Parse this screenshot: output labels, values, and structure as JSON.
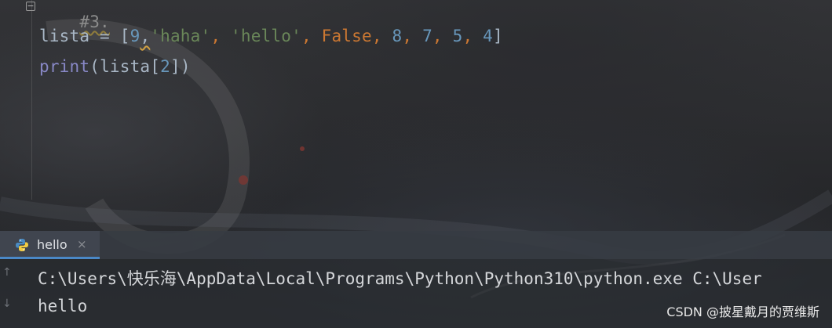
{
  "editor": {
    "comment_line": "#3.",
    "line2": {
      "var": "lista",
      "assign": " = ",
      "open": "[",
      "n9": "9",
      "comma_warn": ",",
      "s1": "'haha'",
      "sep1": ", ",
      "s2": "'hello'",
      "sep2": ", ",
      "kw_false": "False",
      "sep3": ", ",
      "n8": "8",
      "sep4": ", ",
      "n7": "7",
      "sep5": ", ",
      "n5": "5",
      "sep6": ", ",
      "n4": "4",
      "close": "]"
    },
    "line3": {
      "fn": "print",
      "open": "(",
      "var": "lista",
      "bopen": "[",
      "idx": "2",
      "bclose": "]",
      "close": ")"
    }
  },
  "run_panel": {
    "tab_label": "hello",
    "tab_close": "×",
    "console": {
      "command": "C:\\Users\\快乐海\\AppData\\Local\\Programs\\Python\\Python310\\python.exe C:\\User",
      "output": "hello"
    }
  },
  "watermark": "CSDN @披星戴月的贾维斯",
  "icons": {
    "fold": "fold-icon",
    "python": "python-icon",
    "up": "arrow-up-icon",
    "down": "arrow-down-icon"
  },
  "colors": {
    "number": "#6897bb",
    "string": "#6a8759",
    "keyword": "#cc7832",
    "builtin": "#8888c6",
    "default": "#a9b7c6",
    "tab_accent": "#4a88c7"
  }
}
